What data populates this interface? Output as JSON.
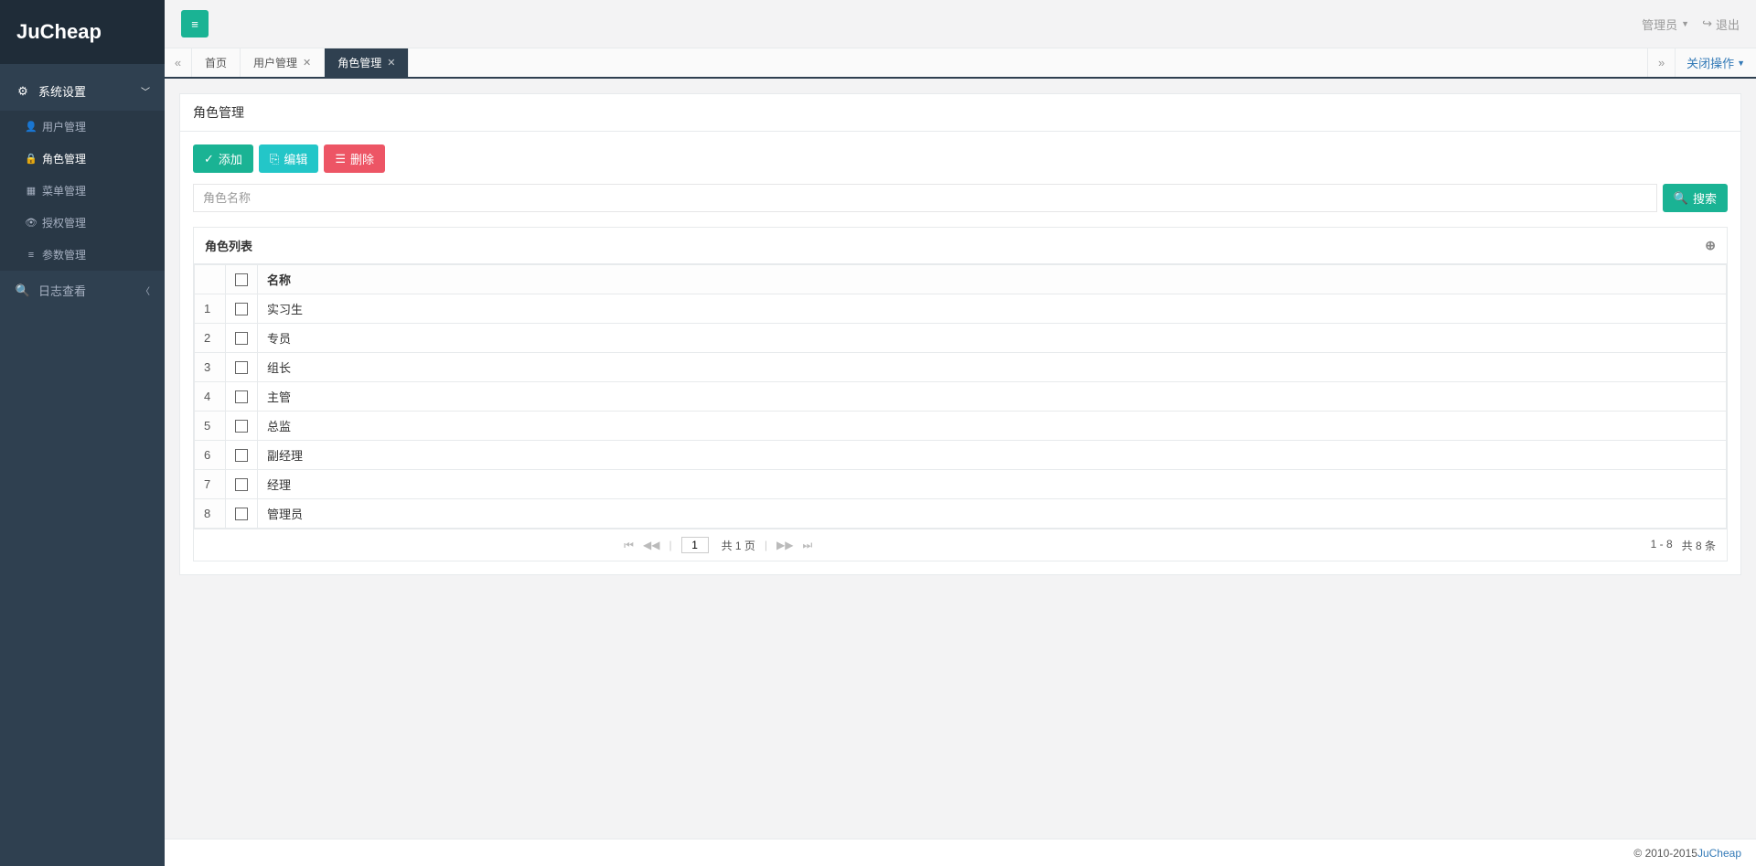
{
  "logo": "JuCheap",
  "sidebar": {
    "items": [
      {
        "icon": "⚙",
        "label": "系统设置",
        "expanded": true,
        "children": [
          {
            "icon": "👤",
            "label": "用户管理"
          },
          {
            "icon": "🔒",
            "label": "角色管理",
            "active": true
          },
          {
            "icon": "▦",
            "label": "菜单管理"
          },
          {
            "icon": "👁",
            "label": "授权管理"
          },
          {
            "icon": "≡",
            "label": "参数管理"
          }
        ]
      },
      {
        "icon": "🔍",
        "label": "日志查看",
        "expanded": false
      }
    ]
  },
  "topbar": {
    "user": "管理员",
    "logout": "退出"
  },
  "tabbar": {
    "tabs": [
      {
        "label": "首页",
        "closable": false,
        "active": false
      },
      {
        "label": "用户管理",
        "closable": true,
        "active": false
      },
      {
        "label": "角色管理",
        "closable": true,
        "active": true
      }
    ],
    "close_ops": "关闭操作"
  },
  "page": {
    "title": "角色管理",
    "buttons": {
      "add": "添加",
      "edit": "编辑",
      "del": "删除"
    },
    "search": {
      "placeholder": "角色名称",
      "btn": "搜索"
    },
    "grid": {
      "title": "角色列表",
      "columns": {
        "name": "名称"
      },
      "rows": [
        {
          "n": "1",
          "name": "实习生"
        },
        {
          "n": "2",
          "name": "专员"
        },
        {
          "n": "3",
          "name": "组长"
        },
        {
          "n": "4",
          "name": "主管"
        },
        {
          "n": "5",
          "name": "总监"
        },
        {
          "n": "6",
          "name": "副经理"
        },
        {
          "n": "7",
          "name": "经理"
        },
        {
          "n": "8",
          "name": "管理员"
        }
      ],
      "pager": {
        "page": "1",
        "total_pages": "共 1 页",
        "range": "1 - 8",
        "total_records": "共 8 条"
      }
    }
  },
  "footer": {
    "copyright": "© 2010-2015 ",
    "brand": "JuCheap"
  }
}
